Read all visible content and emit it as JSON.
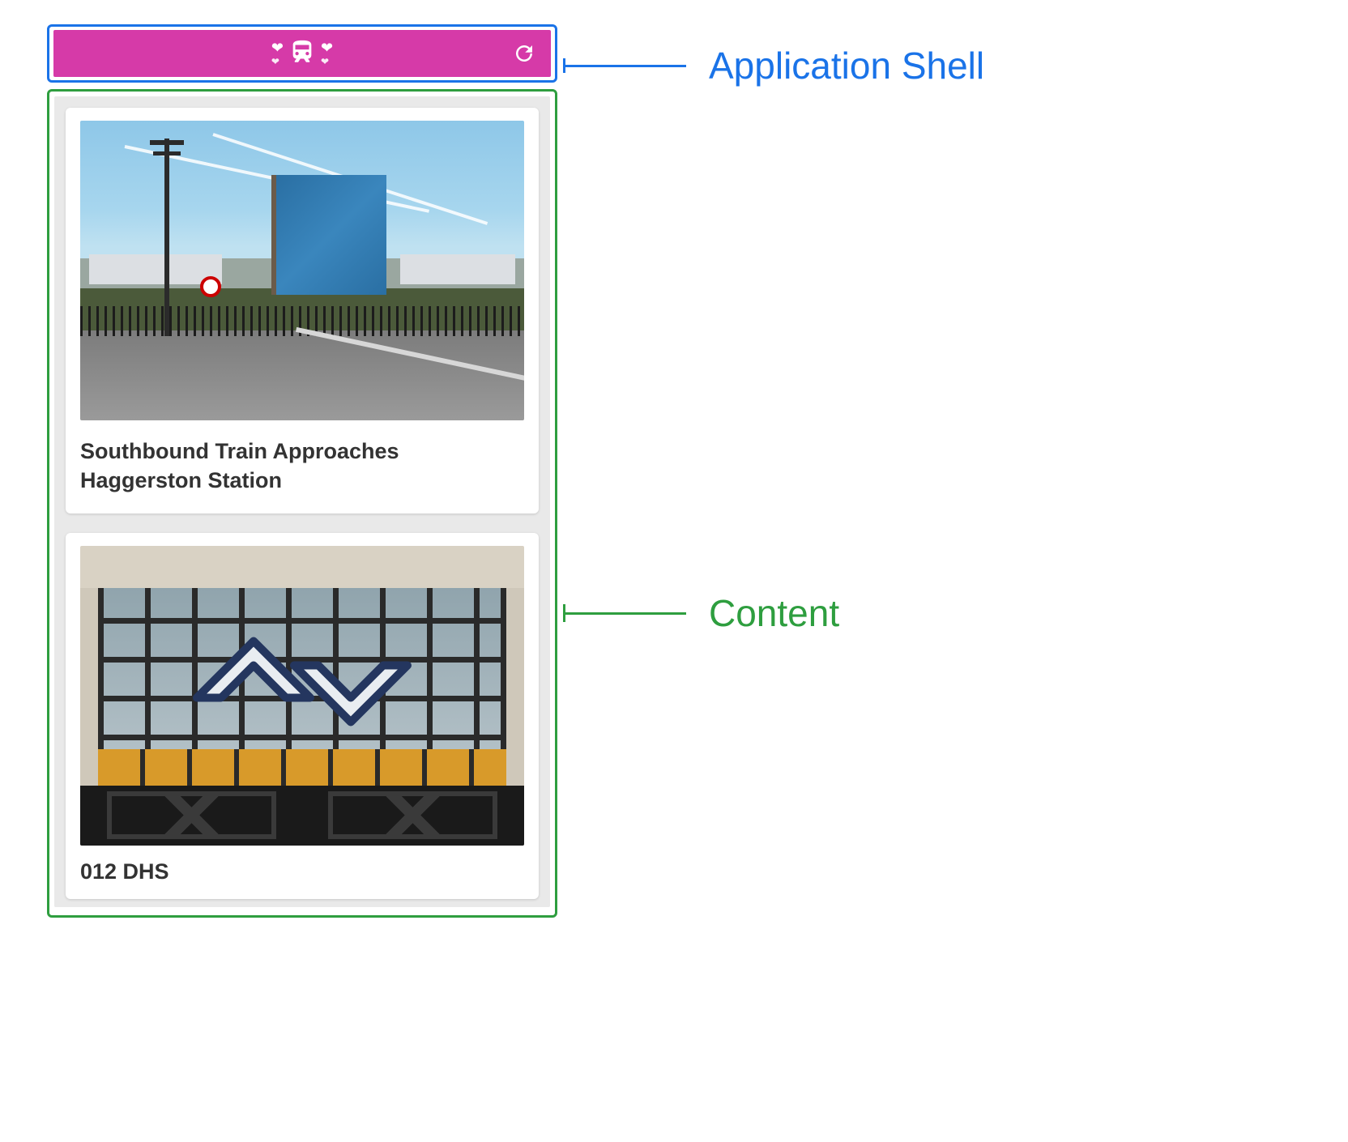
{
  "shell": {
    "brand_icon": "train-hearts-icon",
    "refresh_icon": "refresh-icon"
  },
  "content": {
    "cards": [
      {
        "title": "Southbound Train Approaches Haggerston Station"
      },
      {
        "title": "012 DHS"
      }
    ]
  },
  "annotations": {
    "shell_label": "Application Shell",
    "content_label": "Content"
  },
  "colors": {
    "shell_outline": "#1a73e8",
    "content_outline": "#2e9e3f",
    "header_bg": "#d63aa8"
  }
}
